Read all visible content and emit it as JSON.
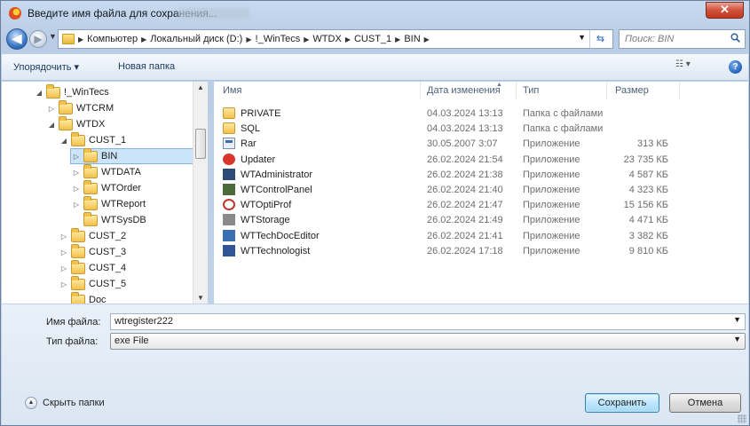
{
  "window": {
    "title": "Введите имя файла для сохранения...",
    "close_glyph": "✕"
  },
  "address": {
    "crumbs": [
      "Компьютер",
      "Локальный диск (D:)",
      "!_WinTecs",
      "WTDX",
      "CUST_1",
      "BIN"
    ],
    "search_placeholder": "Поиск: BIN"
  },
  "toolbar": {
    "organize_label": "Упорядочить ▾",
    "new_folder_label": "Новая папка"
  },
  "tree": [
    {
      "label": "!_WinTecs",
      "indent": 0,
      "twisty": "◢",
      "selected": false
    },
    {
      "label": "WTCRM",
      "indent": 1,
      "twisty": "▷",
      "selected": false
    },
    {
      "label": "WTDX",
      "indent": 1,
      "twisty": "◢",
      "selected": false
    },
    {
      "label": "CUST_1",
      "indent": 2,
      "twisty": "◢",
      "selected": false
    },
    {
      "label": "BIN",
      "indent": 3,
      "twisty": "▷",
      "selected": true
    },
    {
      "label": "WTDATA",
      "indent": 3,
      "twisty": "▷",
      "selected": false
    },
    {
      "label": "WTOrder",
      "indent": 3,
      "twisty": "▷",
      "selected": false
    },
    {
      "label": "WTReport",
      "indent": 3,
      "twisty": "▷",
      "selected": false
    },
    {
      "label": "WTSysDB",
      "indent": 3,
      "twisty": "",
      "selected": false
    },
    {
      "label": "CUST_2",
      "indent": 2,
      "twisty": "▷",
      "selected": false
    },
    {
      "label": "CUST_3",
      "indent": 2,
      "twisty": "▷",
      "selected": false
    },
    {
      "label": "CUST_4",
      "indent": 2,
      "twisty": "▷",
      "selected": false
    },
    {
      "label": "CUST_5",
      "indent": 2,
      "twisty": "▷",
      "selected": false
    },
    {
      "label": "Doc",
      "indent": 2,
      "twisty": "",
      "selected": false
    }
  ],
  "columns": {
    "name": "Имя",
    "date": "Дата изменения",
    "type": "Тип",
    "size": "Размер"
  },
  "files": [
    {
      "name": "PRIVATE",
      "date": "04.03.2024 13:13",
      "type": "Папка с файлами",
      "size": "",
      "icon": "folder-icon"
    },
    {
      "name": "SQL",
      "date": "04.03.2024 13:13",
      "type": "Папка с файлами",
      "size": "",
      "icon": "folder-icon"
    },
    {
      "name": "Rar",
      "date": "30.05.2007 3:07",
      "type": "Приложение",
      "size": "313 КБ",
      "icon": "app-window-icon"
    },
    {
      "name": "Updater",
      "date": "26.02.2024 21:54",
      "type": "Приложение",
      "size": "23 735 КБ",
      "icon": "updater-icon"
    },
    {
      "name": "WTAdministrator",
      "date": "26.02.2024 21:38",
      "type": "Приложение",
      "size": "4 587 КБ",
      "icon": "admin-icon"
    },
    {
      "name": "WTControlPanel",
      "date": "26.02.2024 21:40",
      "type": "Приложение",
      "size": "4 323 КБ",
      "icon": "control-panel-icon"
    },
    {
      "name": "WTOptiProf",
      "date": "26.02.2024 21:47",
      "type": "Приложение",
      "size": "15 156 КБ",
      "icon": "optiprof-icon"
    },
    {
      "name": "WTStorage",
      "date": "26.02.2024 21:49",
      "type": "Приложение",
      "size": "4 471 КБ",
      "icon": "storage-icon"
    },
    {
      "name": "WTTechDocEditor",
      "date": "26.02.2024 21:41",
      "type": "Приложение",
      "size": "3 382 КБ",
      "icon": "techdoc-icon"
    },
    {
      "name": "WTTechnologist",
      "date": "26.02.2024 17:18",
      "type": "Приложение",
      "size": "9 810 КБ",
      "icon": "technologist-icon"
    }
  ],
  "form": {
    "filename_label": "Имя файла:",
    "filename_value": "wtregister222",
    "filetype_label": "Тип файла:",
    "filetype_value": "exe File"
  },
  "footer": {
    "hide_folders_label": "Скрыть папки",
    "save_label": "Сохранить",
    "cancel_label": "Отмена"
  },
  "colors": {
    "selection": "#cce4f7",
    "accent": "#3c7fb1",
    "close": "#c0391f"
  }
}
